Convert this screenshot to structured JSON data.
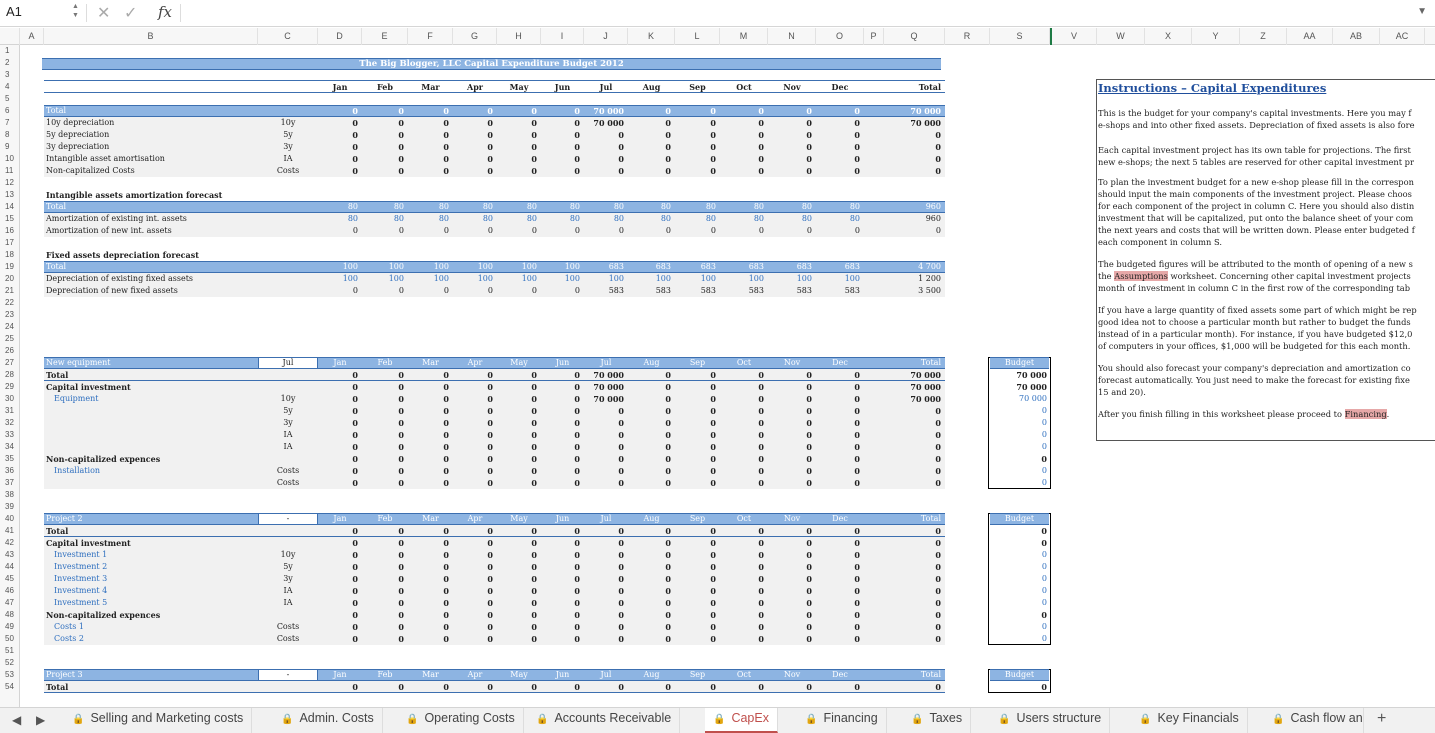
{
  "formula_bar": {
    "cell_ref": "A1",
    "cancel_glyph": "✕",
    "confirm_glyph": "✓",
    "fx_label": "fx",
    "expand_glyph": "▼",
    "value": ""
  },
  "columns": [
    "A",
    "B",
    "C",
    "D",
    "E",
    "F",
    "G",
    "H",
    "I",
    "J",
    "K",
    "L",
    "M",
    "N",
    "O",
    "P",
    "Q",
    "R",
    "S",
    "V",
    "W",
    "X",
    "Y",
    "Z",
    "AA",
    "AB",
    "AC"
  ],
  "row_numbers": [
    "1",
    "2",
    "3",
    "4",
    "5",
    "6",
    "7",
    "8",
    "9",
    "10",
    "11",
    "12",
    "13",
    "14",
    "15",
    "16",
    "17",
    "18",
    "19",
    "20",
    "21",
    "22",
    "23",
    "24",
    "25",
    "26",
    "27",
    "28",
    "29",
    "30",
    "31",
    "32",
    "33",
    "34",
    "35",
    "36",
    "37",
    "38",
    "39",
    "40",
    "41",
    "42",
    "43",
    "44",
    "45",
    "46",
    "47",
    "48",
    "49",
    "50",
    "51",
    "52",
    "53",
    "54"
  ],
  "sheet_title": "The Big Blogger, LLC Capital Expenditure Budget 2012",
  "months": [
    "Jan",
    "Feb",
    "Mar",
    "Apr",
    "May",
    "Jun",
    "Jul",
    "Aug",
    "Sep",
    "Oct",
    "Nov",
    "Dec"
  ],
  "total_label": "Total",
  "budget_label": "Budget",
  "sec1": {
    "rows": [
      {
        "l": "Total",
        "c": "",
        "v": [
          "0",
          "0",
          "0",
          "0",
          "0",
          "0",
          "70 000",
          "0",
          "0",
          "0",
          "0",
          "0"
        ],
        "t": "70 000",
        "style": "hdr"
      },
      {
        "l": "10y depreciation",
        "c": "10y",
        "v": [
          "0",
          "0",
          "0",
          "0",
          "0",
          "0",
          "70 000",
          "0",
          "0",
          "0",
          "0",
          "0"
        ],
        "t": "70 000"
      },
      {
        "l": "5y depreciation",
        "c": "5y",
        "v": [
          "0",
          "0",
          "0",
          "0",
          "0",
          "0",
          "0",
          "0",
          "0",
          "0",
          "0",
          "0"
        ],
        "t": "0"
      },
      {
        "l": "3y depreciation",
        "c": "3y",
        "v": [
          "0",
          "0",
          "0",
          "0",
          "0",
          "0",
          "0",
          "0",
          "0",
          "0",
          "0",
          "0"
        ],
        "t": "0"
      },
      {
        "l": "Intangible asset amortisation",
        "c": "IA",
        "v": [
          "0",
          "0",
          "0",
          "0",
          "0",
          "0",
          "0",
          "0",
          "0",
          "0",
          "0",
          "0"
        ],
        "t": "0"
      },
      {
        "l": "Non-capitalized Costs",
        "c": "Costs",
        "v": [
          "0",
          "0",
          "0",
          "0",
          "0",
          "0",
          "0",
          "0",
          "0",
          "0",
          "0",
          "0"
        ],
        "t": "0"
      }
    ]
  },
  "sec2": {
    "title": "Intangible assets amortization forecast",
    "rows": [
      {
        "l": "Total",
        "v": [
          "80",
          "80",
          "80",
          "80",
          "80",
          "80",
          "80",
          "80",
          "80",
          "80",
          "80",
          "80"
        ],
        "t": "960",
        "style": "hdr"
      },
      {
        "l": "Amortization of existing int. assets",
        "v": [
          "80",
          "80",
          "80",
          "80",
          "80",
          "80",
          "80",
          "80",
          "80",
          "80",
          "80",
          "80"
        ],
        "t": "960",
        "blue": true
      },
      {
        "l": "Amortization of new int. assets",
        "v": [
          "0",
          "0",
          "0",
          "0",
          "0",
          "0",
          "0",
          "0",
          "0",
          "0",
          "0",
          "0"
        ],
        "t": "0"
      }
    ]
  },
  "sec3": {
    "title": "Fixed assets depreciation forecast",
    "rows": [
      {
        "l": "Total",
        "v": [
          "100",
          "100",
          "100",
          "100",
          "100",
          "100",
          "683",
          "683",
          "683",
          "683",
          "683",
          "683"
        ],
        "t": "4 700",
        "style": "hdr"
      },
      {
        "l": "Depreciation of existing fixed assets",
        "v": [
          "100",
          "100",
          "100",
          "100",
          "100",
          "100",
          "100",
          "100",
          "100",
          "100",
          "100",
          "100"
        ],
        "t": "1 200",
        "blue": true
      },
      {
        "l": "Depreciation of new fixed assets",
        "v": [
          "0",
          "0",
          "0",
          "0",
          "0",
          "0",
          "583",
          "583",
          "583",
          "583",
          "583",
          "583"
        ],
        "t": "3 500"
      }
    ]
  },
  "projects": [
    {
      "name": "New equipment",
      "month": "Jul",
      "rows": [
        {
          "l": "Total",
          "c": "",
          "v": [
            "0",
            "0",
            "0",
            "0",
            "0",
            "0",
            "70 000",
            "0",
            "0",
            "0",
            "0",
            "0"
          ],
          "t": "70 000",
          "bud": "70 000",
          "bold": true
        },
        {
          "l": "Capital investment",
          "c": "",
          "v": [
            "0",
            "0",
            "0",
            "0",
            "0",
            "0",
            "70 000",
            "0",
            "0",
            "0",
            "0",
            "0"
          ],
          "t": "70 000",
          "bud": "70 000",
          "bold": true
        },
        {
          "l": "Equipment",
          "c": "10y",
          "v": [
            "0",
            "0",
            "0",
            "0",
            "0",
            "0",
            "70 000",
            "0",
            "0",
            "0",
            "0",
            "0"
          ],
          "t": "70 000",
          "bud": "70 000",
          "sub": true
        },
        {
          "l": "",
          "c": "5y",
          "v": [
            "0",
            "0",
            "0",
            "0",
            "0",
            "0",
            "0",
            "0",
            "0",
            "0",
            "0",
            "0"
          ],
          "t": "0",
          "bud": "0",
          "sub": true
        },
        {
          "l": "",
          "c": "3y",
          "v": [
            "0",
            "0",
            "0",
            "0",
            "0",
            "0",
            "0",
            "0",
            "0",
            "0",
            "0",
            "0"
          ],
          "t": "0",
          "bud": "0",
          "sub": true
        },
        {
          "l": "",
          "c": "IA",
          "v": [
            "0",
            "0",
            "0",
            "0",
            "0",
            "0",
            "0",
            "0",
            "0",
            "0",
            "0",
            "0"
          ],
          "t": "0",
          "bud": "0",
          "sub": true
        },
        {
          "l": "",
          "c": "IA",
          "v": [
            "0",
            "0",
            "0",
            "0",
            "0",
            "0",
            "0",
            "0",
            "0",
            "0",
            "0",
            "0"
          ],
          "t": "0",
          "bud": "0",
          "sub": true
        },
        {
          "l": "Non-capitalized expences",
          "c": "",
          "v": [
            "0",
            "0",
            "0",
            "0",
            "0",
            "0",
            "0",
            "0",
            "0",
            "0",
            "0",
            "0"
          ],
          "t": "0",
          "bud": "0",
          "bold": true
        },
        {
          "l": "Installation",
          "c": "Costs",
          "v": [
            "0",
            "0",
            "0",
            "0",
            "0",
            "0",
            "0",
            "0",
            "0",
            "0",
            "0",
            "0"
          ],
          "t": "0",
          "bud": "0",
          "sub": true
        },
        {
          "l": "",
          "c": "Costs",
          "v": [
            "0",
            "0",
            "0",
            "0",
            "0",
            "0",
            "0",
            "0",
            "0",
            "0",
            "0",
            "0"
          ],
          "t": "0",
          "bud": "0",
          "sub": true
        }
      ]
    },
    {
      "name": "Project 2",
      "month": "-",
      "rows": [
        {
          "l": "Total",
          "c": "",
          "v": [
            "0",
            "0",
            "0",
            "0",
            "0",
            "0",
            "0",
            "0",
            "0",
            "0",
            "0",
            "0"
          ],
          "t": "0",
          "bud": "0",
          "bold": true
        },
        {
          "l": "Capital investment",
          "c": "",
          "v": [
            "0",
            "0",
            "0",
            "0",
            "0",
            "0",
            "0",
            "0",
            "0",
            "0",
            "0",
            "0"
          ],
          "t": "0",
          "bud": "0",
          "bold": true
        },
        {
          "l": "Investment 1",
          "c": "10y",
          "v": [
            "0",
            "0",
            "0",
            "0",
            "0",
            "0",
            "0",
            "0",
            "0",
            "0",
            "0",
            "0"
          ],
          "t": "0",
          "bud": "0",
          "sub": true
        },
        {
          "l": "Investment 2",
          "c": "5y",
          "v": [
            "0",
            "0",
            "0",
            "0",
            "0",
            "0",
            "0",
            "0",
            "0",
            "0",
            "0",
            "0"
          ],
          "t": "0",
          "bud": "0",
          "sub": true
        },
        {
          "l": "Investment 3",
          "c": "3y",
          "v": [
            "0",
            "0",
            "0",
            "0",
            "0",
            "0",
            "0",
            "0",
            "0",
            "0",
            "0",
            "0"
          ],
          "t": "0",
          "bud": "0",
          "sub": true
        },
        {
          "l": "Investment 4",
          "c": "IA",
          "v": [
            "0",
            "0",
            "0",
            "0",
            "0",
            "0",
            "0",
            "0",
            "0",
            "0",
            "0",
            "0"
          ],
          "t": "0",
          "bud": "0",
          "sub": true
        },
        {
          "l": "Investment 5",
          "c": "IA",
          "v": [
            "0",
            "0",
            "0",
            "0",
            "0",
            "0",
            "0",
            "0",
            "0",
            "0",
            "0",
            "0"
          ],
          "t": "0",
          "bud": "0",
          "sub": true
        },
        {
          "l": "Non-capitalized expences",
          "c": "",
          "v": [
            "0",
            "0",
            "0",
            "0",
            "0",
            "0",
            "0",
            "0",
            "0",
            "0",
            "0",
            "0"
          ],
          "t": "0",
          "bud": "0",
          "bold": true
        },
        {
          "l": "Costs 1",
          "c": "Costs",
          "v": [
            "0",
            "0",
            "0",
            "0",
            "0",
            "0",
            "0",
            "0",
            "0",
            "0",
            "0",
            "0"
          ],
          "t": "0",
          "bud": "0",
          "sub": true
        },
        {
          "l": "Costs 2",
          "c": "Costs",
          "v": [
            "0",
            "0",
            "0",
            "0",
            "0",
            "0",
            "0",
            "0",
            "0",
            "0",
            "0",
            "0"
          ],
          "t": "0",
          "bud": "0",
          "sub": true
        }
      ]
    },
    {
      "name": "Project 3",
      "month": "-",
      "rows": [
        {
          "l": "Total",
          "c": "",
          "v": [
            "0",
            "0",
            "0",
            "0",
            "0",
            "0",
            "0",
            "0",
            "0",
            "0",
            "0",
            "0"
          ],
          "t": "0",
          "bud": "0",
          "bold": true
        }
      ]
    }
  ],
  "instructions": {
    "title": "Instructions – Capital Expenditures",
    "paragraphs": [
      [
        "This is the budget for your company's capital investments. Here you may f",
        "e-shops and into other fixed assets. Depreciation of fixed assets is also fore"
      ],
      [
        "Each capital investment project has its own table for projections. The first",
        "new e-shops; the next 5 tables are reserved for other capital investment pr"
      ],
      [
        "To plan the investment budget for a new e-shop please fill in the correspon",
        "should input the main components of the investment project. Please choos",
        "for each component of the project in column C. Here you should also distin",
        "investment that will be capitalized, put onto the balance sheet of your com",
        "the next years and costs that will be written down. Please enter budgeted f",
        "each component in column S."
      ],
      [
        "The budgeted figures will be attributed to the month of opening of a new s",
        "the [[Assumptions]] worksheet. Concerning other capital investment projects",
        "month of investment in column C in the first row of the corresponding tab"
      ],
      [
        "If you have a large quantity of fixed assets some part of which might be rep",
        "good idea not to choose a particular month but rather to budget the funds",
        "instead of in a particular month). For instance, if you have budgeted $12,0",
        "of computers in your offices, $1,000 will be budgeted for this each month."
      ],
      [
        "You should also forecast your company's depreciation and amortization co",
        "forecast automatically. You just need to make the forecast for existing fixe",
        "15 and 20)."
      ],
      [
        "After you finish filling in this worksheet please proceed to [[Financing]]."
      ]
    ]
  },
  "tabs": [
    "Selling and Marketing costs",
    "Admin. Costs",
    "Operating Costs",
    "Accounts Receivable",
    "CapEx",
    "Financing",
    "Taxes",
    "Users structure",
    "Key Financials",
    "Cash flow an"
  ],
  "active_tab": "CapEx",
  "nav": {
    "prev": "◀",
    "next": "▶",
    "add": "+"
  },
  "colors": {
    "header_band": "#8db4e2",
    "header_border": "#3c6fb0",
    "active_tab": "#c0504d",
    "link": "#2e6fbf",
    "title": "#1f4e9c"
  }
}
